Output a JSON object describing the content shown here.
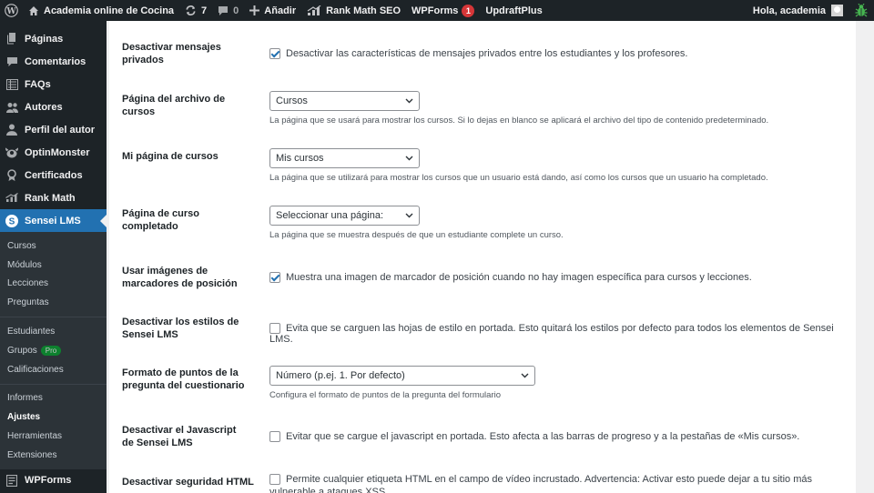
{
  "adminbar": {
    "site_name": "Academia online de Cocina",
    "updates_count": "7",
    "comments_count": "0",
    "new_label": "Añadir",
    "rankmath_label": "Rank Math SEO",
    "wpforms_label": "WPForms",
    "wpforms_count": "1",
    "updraft_label": "UpdraftPlus",
    "greeting": "Hola, academia"
  },
  "sidebar": {
    "items": [
      {
        "label": "Páginas",
        "icon": "pages-icon"
      },
      {
        "label": "Comentarios",
        "icon": "comments-icon"
      },
      {
        "label": "FAQs",
        "icon": "faqs-icon"
      },
      {
        "label": "Autores",
        "icon": "authors-icon"
      },
      {
        "label": "Perfil del autor",
        "icon": "author-profile-icon"
      },
      {
        "label": "OptinMonster",
        "icon": "optinmonster-icon"
      },
      {
        "label": "Certificados",
        "icon": "certificates-icon"
      },
      {
        "label": "Rank Math",
        "icon": "rankmath-icon"
      },
      {
        "label": "Sensei LMS",
        "icon": "sensei-icon"
      }
    ],
    "submenu_group1": [
      "Cursos",
      "Módulos",
      "Lecciones",
      "Preguntas"
    ],
    "submenu_group2": [
      "Estudiantes",
      "Grupos",
      "Calificaciones"
    ],
    "pro_badge": "Pro",
    "submenu_group3": [
      "Informes",
      "Ajustes",
      "Herramientas",
      "Extensiones"
    ],
    "wpforms": "WPForms"
  },
  "settings": {
    "private_messages": {
      "label": "Desactivar mensajes privados",
      "checkbox_label": "Desactivar las características de mensajes privados entre los estudiantes y los profesores.",
      "checked": true
    },
    "course_archive": {
      "label": "Página del archivo de cursos",
      "value": "Cursos",
      "description": "La página que se usará para mostrar los cursos. Si lo dejas en blanco se aplicará el archivo del tipo de contenido predeterminado."
    },
    "my_courses": {
      "label": "Mi página de cursos",
      "value": "Mis cursos",
      "description": "La página que se utilizará para mostrar los cursos que un usuario está dando, así como los cursos que un usuario ha completado."
    },
    "course_completed": {
      "label": "Página de curso completado",
      "value": "Seleccionar una página:",
      "description": "La página que se muestra después de que un estudiante complete un curso."
    },
    "placeholder_images": {
      "label": "Usar imágenes de marcadores de posición",
      "checkbox_label": "Muestra una imagen de marcador de posición cuando no hay imagen específica para cursos y lecciones.",
      "checked": true
    },
    "disable_styles": {
      "label": "Desactivar los estilos de Sensei LMS",
      "checkbox_label": "Evita que se carguen las hojas de estilo en portada. Esto quitará los estilos por defecto para todos los elementos de Sensei LMS.",
      "checked": false
    },
    "quiz_format": {
      "label": "Formato de puntos de la pregunta del cuestionario",
      "value": "Número (p.ej. 1. Por defecto)",
      "description": "Configura el formato de puntos de la pregunta del formulario"
    },
    "disable_js": {
      "label": "Desactivar el Javascript de Sensei LMS",
      "checkbox_label": "Evitar que se cargue el javascript en portada. Esto afecta a las barras de progreso y a la pestañas de «Mis cursos».",
      "checked": false
    },
    "html_security": {
      "label": "Desactivar seguridad HTML",
      "checkbox_label": "Permite cualquier etiqueta HTML en el campo de vídeo incrustado. Advertencia: Activar esto puede dejar a tu sitio más vulnerable a ataques XSS",
      "checked": false
    }
  }
}
